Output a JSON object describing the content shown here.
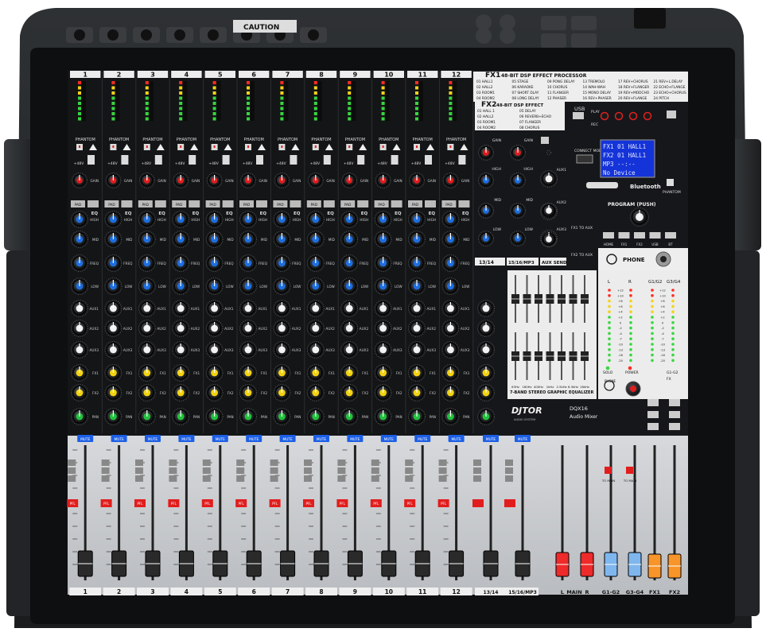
{
  "colors": {
    "case": "#242628",
    "panel": "#131416",
    "lower_panel": "#c9cccf",
    "led_green": "#37d63f",
    "led_yellow": "#f2d417",
    "led_red": "#ff2d24",
    "mute_blue": "#1c5fe6",
    "knob_red": "#e11d1d",
    "knob_blue": "#1d6ee0",
    "knob_white": "#f2f2f2",
    "knob_yellow": "#f3d20e",
    "knob_green": "#22c23c",
    "fader_red": "#ee2a2a",
    "fader_blue": "#7fb6ee",
    "fader_orange": "#f7942a",
    "lcd": "#1433d8"
  },
  "channels": [
    "1",
    "2",
    "3",
    "4",
    "5",
    "6",
    "7",
    "8",
    "9",
    "10",
    "11",
    "12"
  ],
  "stereo_channels": [
    "13/14",
    "15/16/MP3"
  ],
  "channel_labels": {
    "phantom": "PHANTOM",
    "plus48v": "+48V",
    "gain": "GAIN",
    "pad": "PAD",
    "eq": "EQ",
    "high": "HIGH",
    "mid": "MID",
    "freq": "FREQ",
    "low": "LOW",
    "aux1": "AUX1",
    "aux2": "AUX2",
    "aux3": "AUX3",
    "fx1": "FX1",
    "fx2": "FX2",
    "pan": "PAN",
    "mute": "MUTE",
    "pfl": "PFL"
  },
  "fx1": {
    "title": "FX1",
    "subtitle": "48-BIT DSP EFFECT PROCESSOR",
    "presets": [
      "01 HALL1",
      "05 STAGE",
      "09 PONG DELAY",
      "13 TREMOLO",
      "17 REV+CHORUS",
      "21 REV+L.DELAY",
      "02 HALL2",
      "06 KARAOKE",
      "10 CHORUS",
      "14 WAH-WAH",
      "18 REV+FLANGER",
      "22 ECHO+FLANGE",
      "03 ROOM1",
      "07 SHORT DLAY",
      "11 FLANGER",
      "15 MONO DELAY",
      "19 REV+MODCHO",
      "23 ECHO+CHORUS",
      "04 ROOM2",
      "08 LONG DELAY",
      "12 PHASER",
      "16 REV+PHASER",
      "20 REV+FLANGE",
      "24 PITCH"
    ]
  },
  "fx2": {
    "title": "FX2",
    "subtitle": "48-BIT DSP EFFECT",
    "presets": [
      "01 HALL 1",
      "05 DELAY",
      "02 HALL2",
      "06 REVERB+ECHO",
      "03 ROOM1",
      "07 FLANGER",
      "04 ROOM2",
      "08 CHORUS"
    ]
  },
  "usb": {
    "label": "USB",
    "play": "PLAY",
    "rec": "REC",
    "connect_mode": "CONNECT MODE",
    "bluetooth": "Bluetooth",
    "phantom": "PHANTOM",
    "lcd_lines": [
      "FX1 01 HALL1",
      "FX2 01 HALL1",
      "MP3  --:--",
      "No Device"
    ]
  },
  "program": {
    "title": "PROGRAM (PUSH)",
    "buttons": [
      "HOME",
      "FX1",
      "FX2",
      "USB",
      "BT"
    ],
    "fx1_to_aux": "FX1 TO AUX",
    "fx2_to_aux": "FX2 TO AUX"
  },
  "phone": {
    "label": "PHONE",
    "level": "PHONE"
  },
  "meter_master": {
    "headers": [
      "L",
      "R",
      "G1/G2",
      "G3/G4"
    ],
    "scale": [
      "+12",
      "+10",
      "+8",
      "+6",
      "+4",
      "+2",
      "0",
      "-2",
      "-4",
      "-7",
      "-10",
      "-13",
      "-16",
      "-20"
    ],
    "solo": "SOLO",
    "power": "POWER",
    "g12": "G1-G2",
    "fx": "FX"
  },
  "geq": {
    "title": "7-BAND STEREO GRAPHIC EQUALIZER",
    "bands": [
      "63Hz",
      "160Hz",
      "400Hz",
      "1kHz",
      "2.5kHz",
      "6.3kHz",
      "16kHz"
    ]
  },
  "brand": {
    "logo": "DJTOR",
    "sub": "AUDIO SYSTEM",
    "model": "DQX16",
    "type": "Audio Mixer"
  },
  "stereo_section": {
    "labels": [
      "13/14",
      "15/16/MP3",
      "AUX SEND"
    ],
    "aux_labels": [
      "AUX1",
      "AUX2",
      "AUX3"
    ]
  },
  "master_faders": {
    "labels": [
      "L",
      "MAIN",
      "R",
      "G1-G2",
      "G3-G4",
      "FX1",
      "FX2"
    ],
    "to_main": "TO MAIN"
  },
  "fader_scale": [
    "10",
    "5",
    "0",
    "5",
    "10",
    "15",
    "20",
    "30",
    "40",
    "60"
  ],
  "top_labels": {
    "caution": "CAUTION"
  }
}
